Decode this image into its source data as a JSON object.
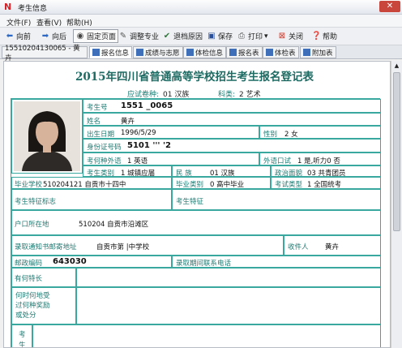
{
  "window": {
    "title": "考生信息",
    "close_label": "✕"
  },
  "menu": [
    "文件(F)",
    "查看(V)",
    "帮助(H)"
  ],
  "toolbar": {
    "prev": "向前",
    "next": "向后",
    "fixed_page": "固定页面",
    "adjust_major": "调整专业",
    "withdraw_reason": "退档原因",
    "save": "保存",
    "print": "打印",
    "print_arrow": "▾",
    "close": "关闭",
    "help": "帮助"
  },
  "tabs": {
    "record": "15510204130065 - 黄卉",
    "signup": "报名信息",
    "scores": "成绩与志愿",
    "physical": "体检信息",
    "signup_form": "报名表",
    "physical_form": "体检表",
    "attachment": "附加表"
  },
  "doc": {
    "title": "2015年四川省普通高等学校招生考生报名登记表",
    "exam_lang_label": "应试卷种:",
    "exam_lang_value": "01 汉族",
    "subject_label": "科类:",
    "subject_value": "2 艺术",
    "exam_no_label": "考生号",
    "exam_no_value": "1551          _0065",
    "name_label": "姓名",
    "name_value": "黄卉",
    "birth_label": "出生日期",
    "birth_value": "1996/5/29",
    "gender_label": "性别",
    "gender_value": "2 女",
    "id_label": "身份证号码",
    "id_value": "5101           '''  '2",
    "foreign_label": "考何种外语",
    "foreign_value": "1 英语",
    "oral_label": "外语口试",
    "oral_value": "1 是,听力0 否",
    "category_label": "考生类别",
    "category_value": "1 城镇应届",
    "nation_label": "民    族",
    "nation_value": "01 汉族",
    "political_label": "政治面貌",
    "political_value": "03 共青团员",
    "school_label": "毕业学校",
    "school_value": "510204121 自贡市十四中",
    "grad_type_label": "毕业类别",
    "grad_type_value": "0 高中毕业",
    "exam_type_label": "考试类型",
    "exam_type_value": "1 全国统考",
    "feature_mark_label": "考生特征标志",
    "feature_label": "考生特征",
    "residence_label": "户口所在地",
    "residence_value": "510204 自贡市沿滩区",
    "mail_addr_label": "录取通知书邮寄地址",
    "mail_addr_value": "自贡市第      |中学校",
    "receiver_label": "收件人",
    "receiver_value": "黄卉",
    "postcode_label": "邮政编码",
    "postcode_value": "643030",
    "contact_label": "录取期间联系电话",
    "specialty_label": "有何特长",
    "award_label": "何时何地受过何种奖励或处分",
    "resume_label": "考生"
  },
  "colors": {
    "accent": "#1f7a72",
    "border": "#39a89f",
    "title": "#1e6b63"
  }
}
